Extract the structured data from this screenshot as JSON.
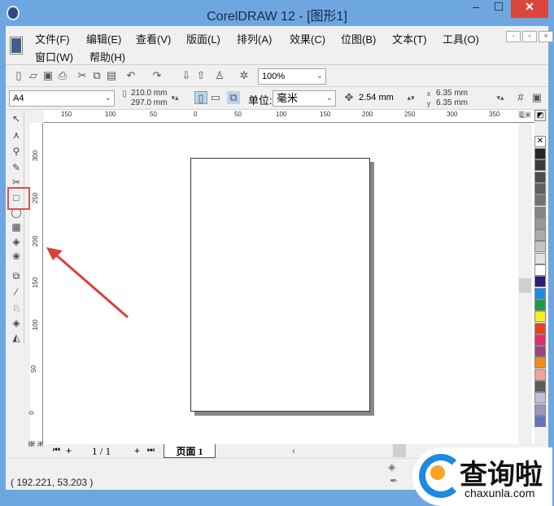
{
  "window": {
    "title": "CorelDRAW 12 - [图形1]",
    "minimize": "–",
    "maximize": "☐",
    "close": "✕"
  },
  "menu": [
    "文件(F)",
    "编辑(E)",
    "查看(V)",
    "版面(L)",
    "排列(A)",
    "效果(C)",
    "位图(B)",
    "文本(T)",
    "工具(O)",
    "窗口(W)",
    "帮助(H)"
  ],
  "toolbar": {
    "zoom": "100%"
  },
  "propertybar": {
    "paper": "A4",
    "width": "210.0 mm",
    "height": "297.0 mm",
    "unit_label": "单位:",
    "unit": "毫米",
    "nudge": "2.54 mm",
    "dup_x": "6.35 mm",
    "dup_y": "6.35 mm"
  },
  "ruler": {
    "h": [
      "150",
      "100",
      "50",
      "0",
      "50",
      "100",
      "150",
      "200",
      "250",
      "300",
      "350",
      "毫米"
    ],
    "v": [
      "300",
      "250",
      "200",
      "150",
      "100",
      "50",
      "0",
      "毫米"
    ]
  },
  "tabs": {
    "page_count": "1 / 1",
    "page_tab": "页面 1"
  },
  "status": {
    "coords": "( 192.221, 53.203 )"
  },
  "palette": [
    "#272727",
    "#3a3a3a",
    "#4d4d4d",
    "#5f5f5f",
    "#727272",
    "#858585",
    "#989898",
    "#ababab",
    "#c4c4c4",
    "#e3e3e3",
    "#ffffff",
    "#2e1a7d",
    "#1a8fe0",
    "#1b9a47",
    "#f5ee1c",
    "#e8411e",
    "#e22b6b",
    "#9b4480",
    "#f18d1a",
    "#f3a39a",
    "#5e5a54",
    "#c6bcdc",
    "#9c95c4",
    "#6474b8"
  ],
  "watermark": {
    "text": "查询啦",
    "url": "chaxunla.com"
  }
}
